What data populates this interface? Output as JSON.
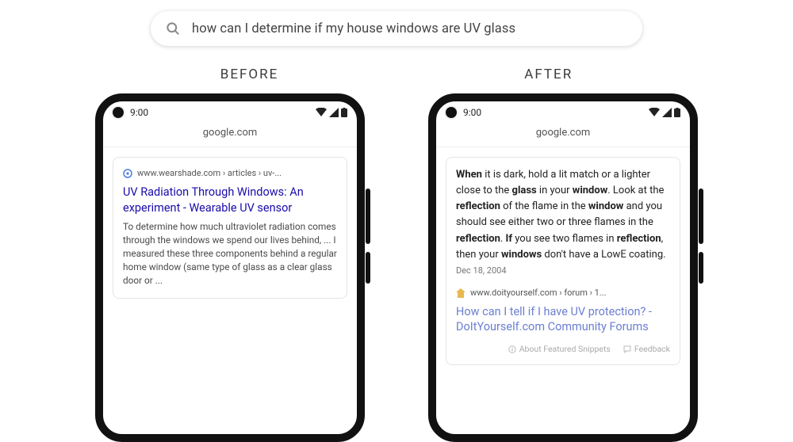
{
  "search": {
    "query": "how can I determine if my house windows are UV glass"
  },
  "labels": {
    "before": "BEFORE",
    "after": "AFTER"
  },
  "statusbar": {
    "time": "9:00",
    "url": "google.com"
  },
  "before": {
    "breadcrumb": "www.wearshade.com › articles › uv-...",
    "title": "UV Radiation Through Windows: An experiment - Wearable UV sensor",
    "snippet": "To determine how much ultraviolet radiation comes through the windows we spend our lives behind, ... I measured these three components behind a regular home window (same type of glass as a clear glass door or   ..."
  },
  "after": {
    "featured_parts": [
      {
        "t": "When",
        "b": true
      },
      {
        "t": " it is dark, hold a lit match or a lighter close to the ",
        "b": false
      },
      {
        "t": "glass",
        "b": true
      },
      {
        "t": " in your ",
        "b": false
      },
      {
        "t": "window",
        "b": true
      },
      {
        "t": ". Look at the ",
        "b": false
      },
      {
        "t": "reflection",
        "b": true
      },
      {
        "t": " of the flame in the ",
        "b": false
      },
      {
        "t": "window",
        "b": true
      },
      {
        "t": " and you should see either two or three flames in the ",
        "b": false
      },
      {
        "t": "reflection",
        "b": true
      },
      {
        "t": ". ",
        "b": false
      },
      {
        "t": "If",
        "b": true
      },
      {
        "t": " you see two flames in ",
        "b": false
      },
      {
        "t": "reflection",
        "b": true
      },
      {
        "t": ", then your ",
        "b": false
      },
      {
        "t": "windows",
        "b": true
      },
      {
        "t": " don't have a LowE coating.",
        "b": false
      }
    ],
    "date": "Dec 18, 2004",
    "breadcrumb": "www.doityourself.com › forum › 1...",
    "title": "How can I tell if I have UV protection? - DoItYourself.com Community Forums",
    "footer_about": "About Featured Snippets",
    "footer_feedback": "Feedback"
  }
}
